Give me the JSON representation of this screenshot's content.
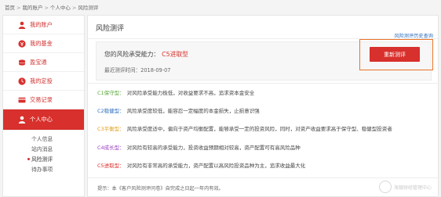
{
  "breadcrumb": {
    "items": [
      "首页",
      "我的账户",
      "个人中心",
      "风险测评"
    ],
    "separator": ">"
  },
  "sidebar": {
    "items": [
      {
        "label": "我的账户",
        "icon": "user-icon"
      },
      {
        "label": "我的基金",
        "icon": "fund-icon"
      },
      {
        "label": "盈宝通",
        "icon": "coins-icon"
      },
      {
        "label": "我的定投",
        "icon": "schedule-icon"
      },
      {
        "label": "交易记录",
        "icon": "card-icon"
      },
      {
        "label": "个人中心",
        "icon": "person-icon",
        "active": true
      }
    ],
    "sub_items": [
      {
        "label": "个人信息"
      },
      {
        "label": "站内消息"
      },
      {
        "label": "风险测评",
        "current": true
      },
      {
        "label": "待办事项"
      }
    ]
  },
  "main": {
    "title": "风险测评",
    "history_link": "风险测评历史查询",
    "result_label": "您的风险承受能力：",
    "result_type": "C5进取型",
    "date_line": "最近测评时间：2018-09-07",
    "retest_button": "重新测评",
    "types": [
      {
        "code": "C1保守型：",
        "desc": "对风险承受能力极低，对收益要求不高，追求资本金安全",
        "color": "#5aa83a"
      },
      {
        "code": "C2稳健型：",
        "desc": "风险承受度较低，能容忍一定幅度的本金损失，止损意识强",
        "color": "#2f6fc0"
      },
      {
        "code": "C3平衡型：",
        "desc": "风险承受度适中，偏向于资产均衡配置，能够承受一定的投资风险，同时，对资产收益要求高于保守型、稳健型投资者",
        "color": "#e0a020"
      },
      {
        "code": "C4成长型：",
        "desc": "对风险有较高的承受能力，投资收益预期相对较高，资产配置可有高风险品种",
        "color": "#9a3fc0"
      },
      {
        "code": "C5进取型：",
        "desc": "对风险有非常高的承受能力，资产配置以高风险投资品种为主，追求收益最大化",
        "color": "#d8302c"
      }
    ],
    "tip": "提示：本《客户风险测评问卷》自完成之日起一年内有效。",
    "watermark": "海银财经管理中心"
  },
  "colors": {
    "accent": "#d8302c",
    "link": "#2f6fc0",
    "highlight_frame": "#e8742a"
  }
}
